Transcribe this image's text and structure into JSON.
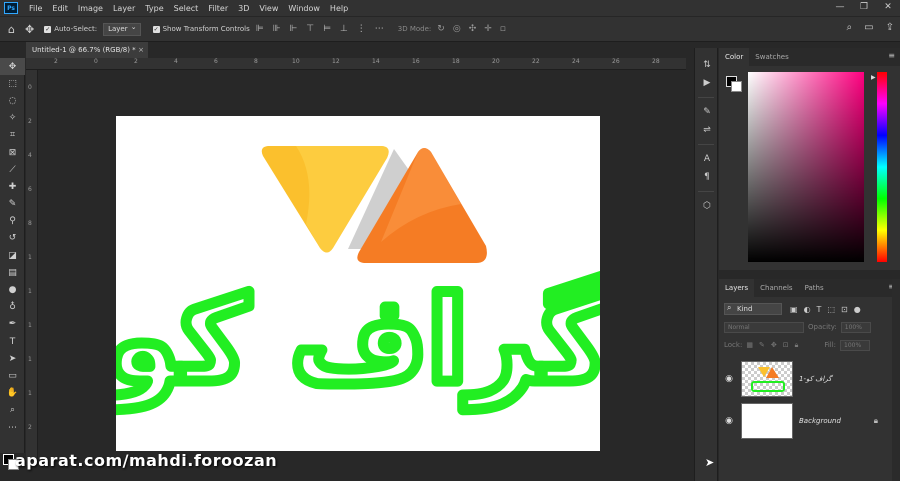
{
  "menu": {
    "logo": "Ps",
    "items": [
      "File",
      "Edit",
      "Image",
      "Layer",
      "Type",
      "Select",
      "Filter",
      "3D",
      "View",
      "Window",
      "Help"
    ],
    "window_controls": [
      "—",
      "❐",
      "✕"
    ]
  },
  "options": {
    "auto_select_label": "Auto-Select:",
    "auto_select_value": "Layer",
    "show_transform_label": "Show Transform Controls",
    "mode3d_label": "3D Mode:"
  },
  "document": {
    "tab_title": "Untitled-1 @ 66.7% (RGB/8) *",
    "close": "×"
  },
  "ruler": {
    "top_ticks": [
      "2",
      "0",
      "2",
      "4",
      "6",
      "8",
      "10",
      "12",
      "14",
      "16",
      "18",
      "20",
      "22",
      "24",
      "26",
      "28"
    ],
    "left_ticks": [
      "0",
      "2",
      "4",
      "6",
      "8",
      "1",
      "1",
      "1",
      "1",
      "1",
      "2",
      "2"
    ]
  },
  "color_panel": {
    "tabs": [
      "Color",
      "Swatches"
    ]
  },
  "layers_panel": {
    "tabs": [
      "Layers",
      "Channels",
      "Paths"
    ],
    "kind_label": "Kind",
    "blend_mode": "Normal",
    "opacity_label": "Opacity:",
    "opacity_value": "100%",
    "lock_label": "Lock:",
    "fill_label": "Fill:",
    "fill_value": "100%",
    "layers": [
      {
        "name": "گراف کو-1",
        "visible": true
      },
      {
        "name": "Background",
        "visible": true
      }
    ]
  },
  "logo_text": "گراف کو",
  "watermark": "aparat.com/mahdi.foroozan",
  "colors": {
    "logo_green": "#22ee22",
    "triangle_yellow": "#fbc02d",
    "triangle_orange": "#f57c24"
  }
}
